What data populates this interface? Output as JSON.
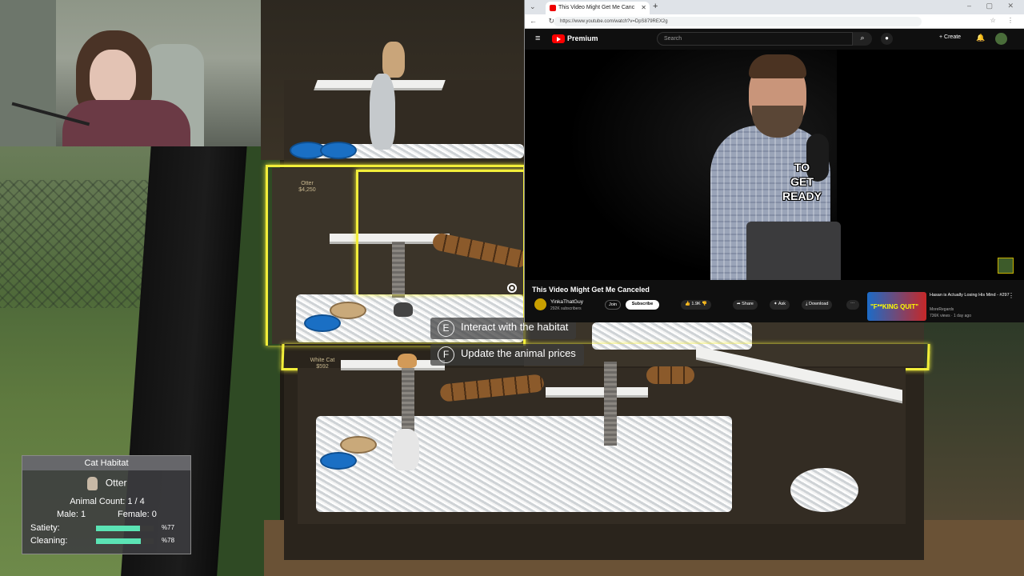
{
  "browser": {
    "tab_title": "This Video Might Get Me Canc",
    "url": "https://www.youtube.com/watch?v=DpS879REX2g",
    "youtube": {
      "brand": "Premium",
      "search_placeholder": "Search",
      "create_label": "Create",
      "caption_lines": [
        "TO",
        "GET",
        "READY"
      ],
      "video_title": "This Video Might Get Me Canceled",
      "channel_name": "YinkaThatGuy",
      "subscriber_count": "292K subscribers",
      "join_label": "Join",
      "subscribe_label": "Subscribe",
      "like_count": "1.9K",
      "share_label": "Share",
      "ask_label": "Ask",
      "download_label": "Download",
      "recommended": {
        "thumb_text": "\"F**KING QUIT\"",
        "title": "Hasan is Actually Losing His Mind - #297",
        "channel": "MoreRegards",
        "meta": "736K views · 1 day ago"
      }
    }
  },
  "game": {
    "habitat_tags": [
      {
        "name": "Otter",
        "price": "$4,250"
      },
      {
        "name": "White Cat",
        "price": "$592"
      }
    ],
    "prompts": [
      {
        "key": "E",
        "label": "Interact with the habitat"
      },
      {
        "key": "F",
        "label": "Update the animal prices"
      }
    ],
    "habitat_panel": {
      "title": "Cat Habitat",
      "animal_name": "Otter",
      "animal_count": "Animal Count: 1 / 4",
      "male": "Male: 1",
      "female": "Female: 0",
      "satiety_label": "Satiety:",
      "satiety_value": 0.77,
      "satiety_text": "%77",
      "cleaning_label": "Cleaning:",
      "cleaning_value": 0.78,
      "cleaning_text": "%78"
    }
  },
  "colors": {
    "highlight": "#f2ee3a",
    "stat_fill": "#5be3b4",
    "youtube_red": "#ff0000"
  }
}
